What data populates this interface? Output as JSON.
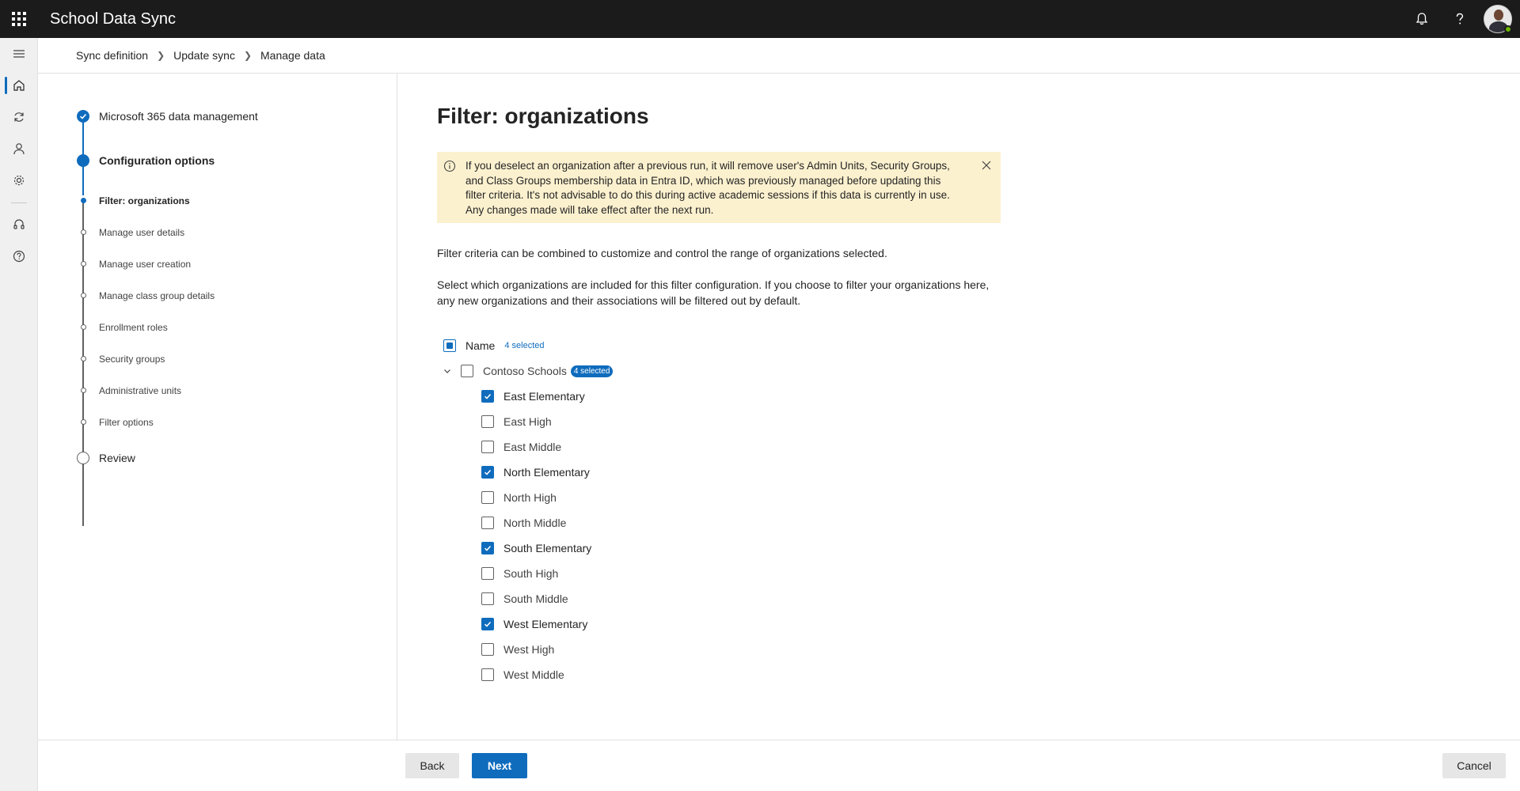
{
  "app": {
    "title": "School Data Sync"
  },
  "icons": {
    "app_launcher": "waffle-icon",
    "notifications": "bell-icon",
    "help": "question-icon",
    "avatar": "user-avatar"
  },
  "rail": [
    {
      "name": "menu",
      "icon": "hamburger-icon"
    },
    {
      "name": "home",
      "icon": "home-icon",
      "active": true
    },
    {
      "name": "sync",
      "icon": "sync-icon"
    },
    {
      "name": "users",
      "icon": "person-icon"
    },
    {
      "name": "settings",
      "icon": "gear-icon"
    },
    {
      "name": "support",
      "icon": "headset-icon"
    },
    {
      "name": "help",
      "icon": "help-circle-icon"
    }
  ],
  "breadcrumb": [
    "Sync definition",
    "Update sync",
    "Manage data"
  ],
  "steps": [
    {
      "label": "Microsoft 365 data management",
      "level": "major",
      "state": "completed"
    },
    {
      "label": "Configuration options",
      "level": "major",
      "state": "current"
    },
    {
      "label": "Filter: organizations",
      "level": "minor",
      "state": "current"
    },
    {
      "label": "Manage user details",
      "level": "minor",
      "state": "pending"
    },
    {
      "label": "Manage user creation",
      "level": "minor",
      "state": "pending"
    },
    {
      "label": "Manage class group details",
      "level": "minor",
      "state": "pending"
    },
    {
      "label": "Enrollment roles",
      "level": "minor",
      "state": "pending"
    },
    {
      "label": "Security groups",
      "level": "minor",
      "state": "pending"
    },
    {
      "label": "Administrative units",
      "level": "minor",
      "state": "pending"
    },
    {
      "label": "Filter options",
      "level": "minor",
      "state": "pending"
    },
    {
      "label": "Review",
      "level": "major",
      "state": "pending"
    }
  ],
  "main": {
    "title": "Filter: organizations",
    "warning": {
      "lines": [
        "If you deselect an organization after a previous run, it will remove user's Admin Units, Security Groups,",
        "and Class Groups membership data in Entra ID, which was previously managed before updating this",
        "filter criteria. It's not advisable to do this during active academic sessions if this data is currently in use.",
        "Any changes made will take effect after the next run."
      ],
      "color": "#fcf1cf"
    },
    "paragraph1": "Filter criteria can be combined to customize and control the range of organizations selected.",
    "paragraph2_lines": [
      "Select which organizations are included for this filter configuration. If you choose to filter your organizations here,",
      "any new organizations and their associations will be filtered out by default."
    ],
    "tree": {
      "header_label": "Name",
      "header_count": "4 selected",
      "group_label": "Contoso Schools",
      "group_count": "4 selected",
      "items": [
        {
          "label": "East Elementary",
          "checked": true
        },
        {
          "label": "East High",
          "checked": false
        },
        {
          "label": "East Middle",
          "checked": false
        },
        {
          "label": "North Elementary",
          "checked": true
        },
        {
          "label": "North High",
          "checked": false
        },
        {
          "label": "North Middle",
          "checked": false
        },
        {
          "label": "South Elementary",
          "checked": true
        },
        {
          "label": "South High",
          "checked": false
        },
        {
          "label": "South Middle",
          "checked": false
        },
        {
          "label": "West Elementary",
          "checked": true
        },
        {
          "label": "West High",
          "checked": false
        },
        {
          "label": "West Middle",
          "checked": false
        }
      ]
    }
  },
  "footer": {
    "back": "Back",
    "next": "Next",
    "cancel": "Cancel"
  },
  "colors": {
    "accent": "#0f6cbd",
    "topbar": "#1b1b1b",
    "warning_bg": "#fcf1cf"
  }
}
